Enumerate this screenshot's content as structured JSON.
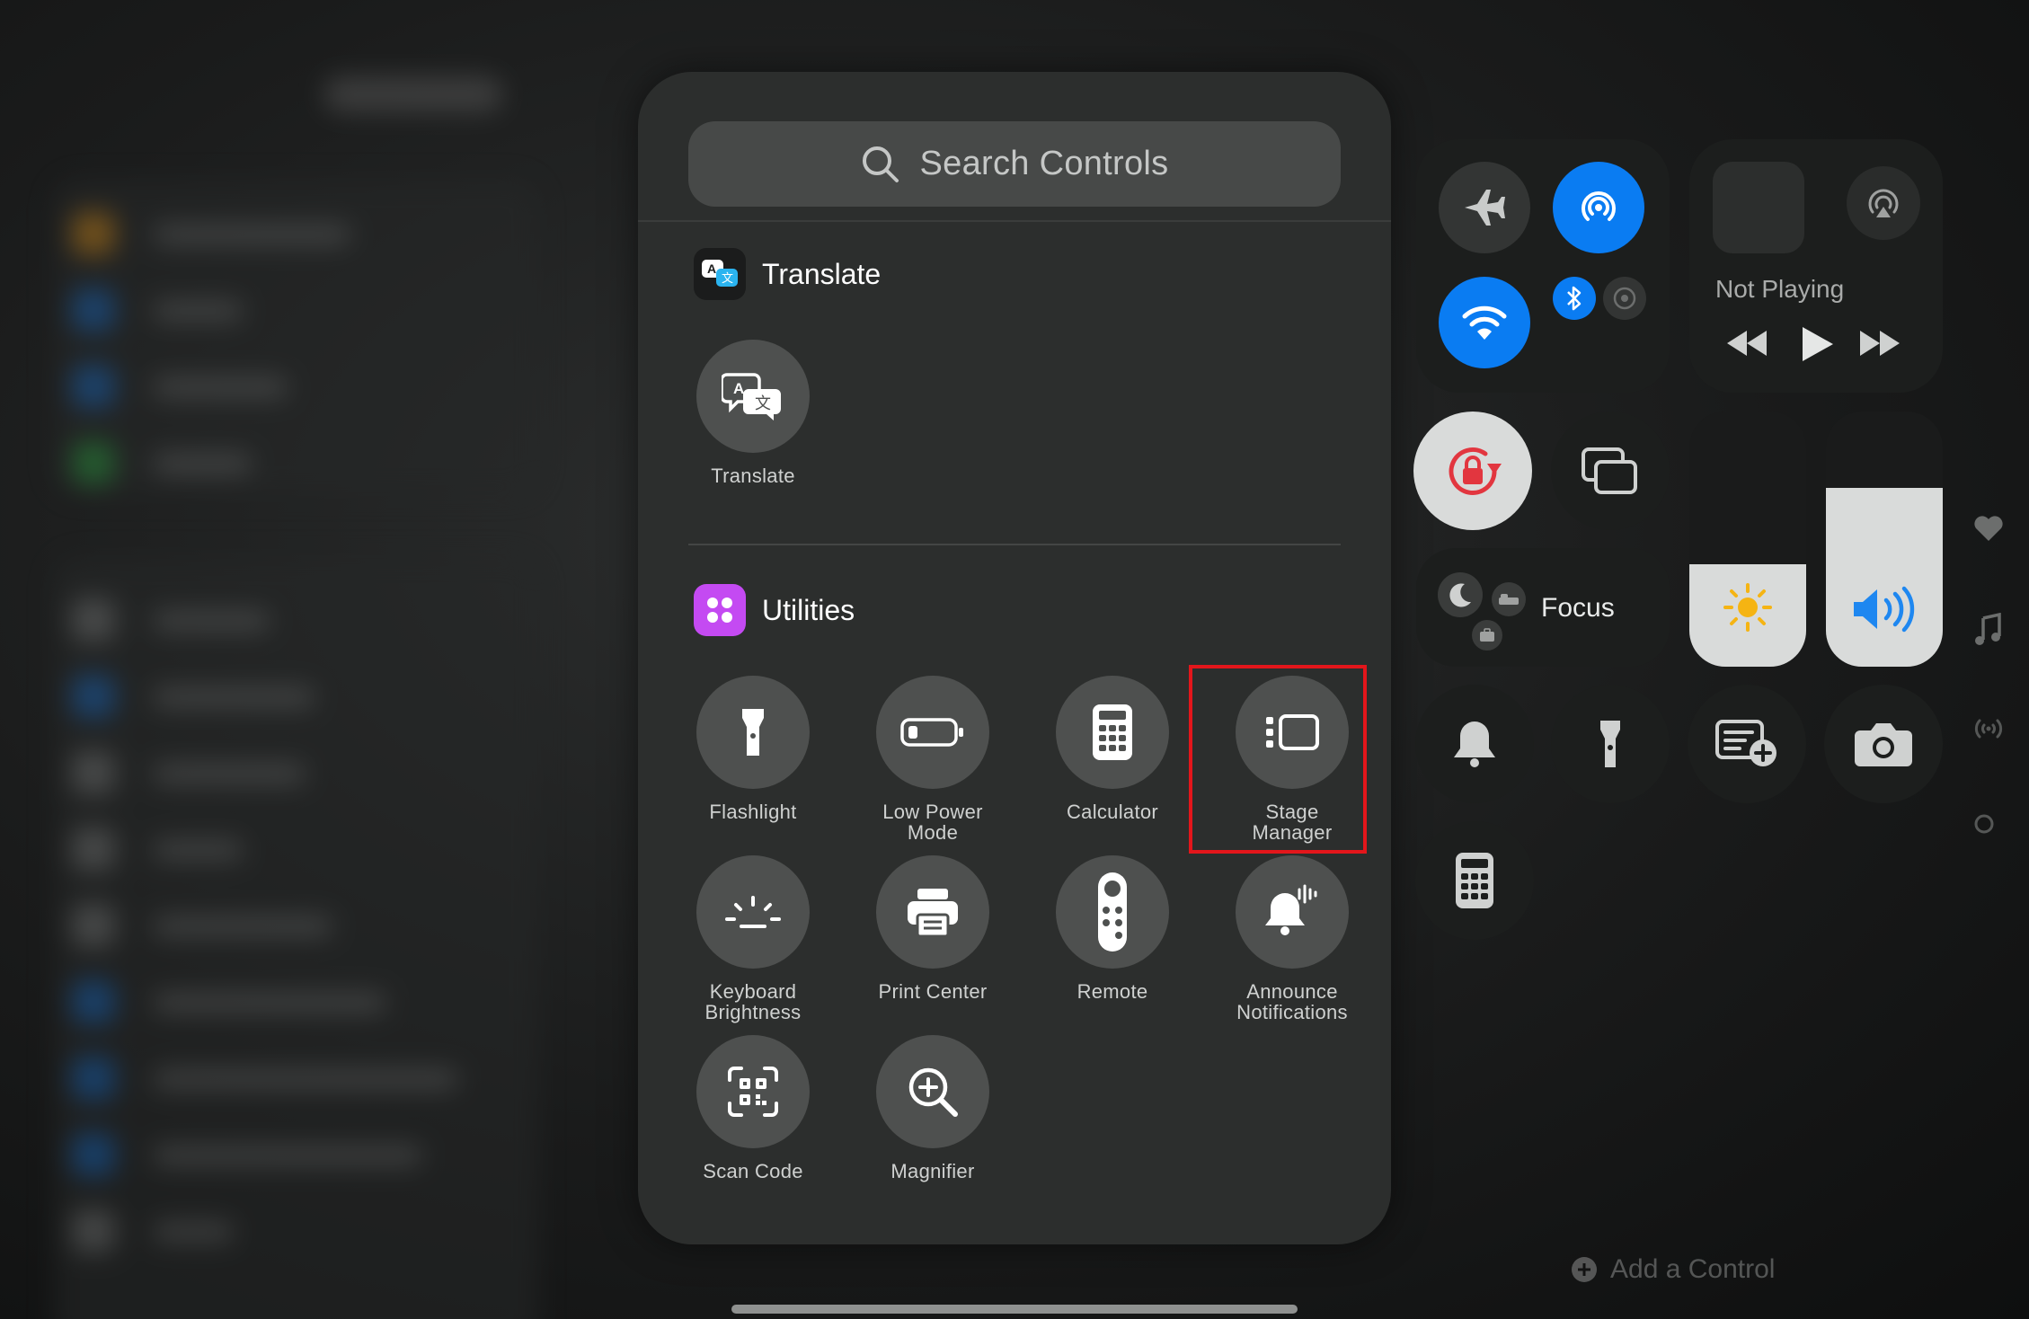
{
  "search": {
    "placeholder": "Search Controls",
    "icon": "magnifying-glass-icon"
  },
  "sections": {
    "translate": {
      "title": "Translate",
      "controls": [
        {
          "label": "Translate",
          "icon": "translate-bubbles-icon"
        }
      ]
    },
    "utilities": {
      "title": "Utilities",
      "accent": "#c44af2",
      "controls": [
        {
          "label": "Flashlight",
          "icon": "flashlight-icon"
        },
        {
          "label": "Low Power Mode",
          "icon": "battery-icon"
        },
        {
          "label": "Calculator",
          "icon": "calculator-icon"
        },
        {
          "label": "Stage Manager",
          "icon": "stage-manager-icon",
          "highlighted": true
        },
        {
          "label": "Keyboard Brightness",
          "icon": "keyboard-brightness-icon"
        },
        {
          "label": "Print Center",
          "icon": "printer-icon"
        },
        {
          "label": "Remote",
          "icon": "tv-remote-icon"
        },
        {
          "label": "Announce Notifications",
          "icon": "announce-bell-icon"
        },
        {
          "label": "Scan Code",
          "icon": "qr-code-icon"
        },
        {
          "label": "Magnifier",
          "icon": "magnifier-icon"
        }
      ]
    }
  },
  "control_center": {
    "now_playing": "Not Playing",
    "focus": "Focus",
    "add_control": "Add a Control",
    "toggles": {
      "airplane_mode": "off",
      "airdrop": "on",
      "wifi": "on",
      "bluetooth": "on",
      "cellular": "off",
      "orientation_lock": "on"
    },
    "brightness_level": 0.4,
    "volume_level": 0.7,
    "accent_blue": "#0a7cf2"
  },
  "colors": {
    "highlight_border": "#e3161b",
    "panel_bg": "#2c2e2d",
    "control_bg": "#4e504f"
  }
}
